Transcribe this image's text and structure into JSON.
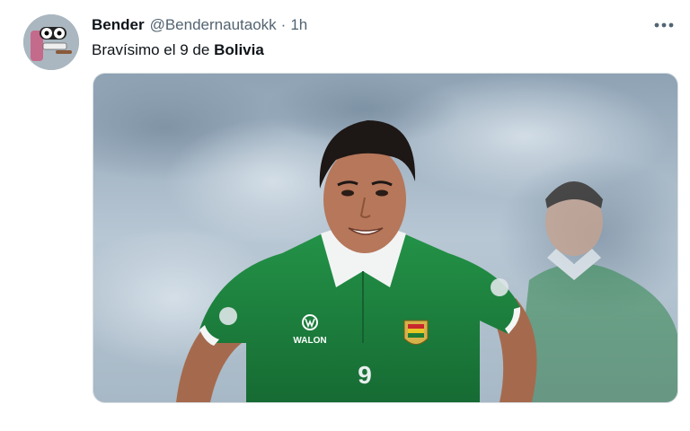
{
  "tweet": {
    "display_name": "Bender",
    "handle": "@Bendernautaokk",
    "separator": "·",
    "time": "1h",
    "text_prefix": "Bravísimo el 9 de ",
    "text_bold": "Bolivia"
  },
  "media": {
    "jersey_brand": "WALON",
    "jersey_number": "9"
  },
  "icons": {
    "more": "more-horizontal-icon"
  },
  "colors": {
    "text_primary": "#0f1419",
    "text_secondary": "#536471",
    "jersey_green": "#1f8a3c"
  }
}
